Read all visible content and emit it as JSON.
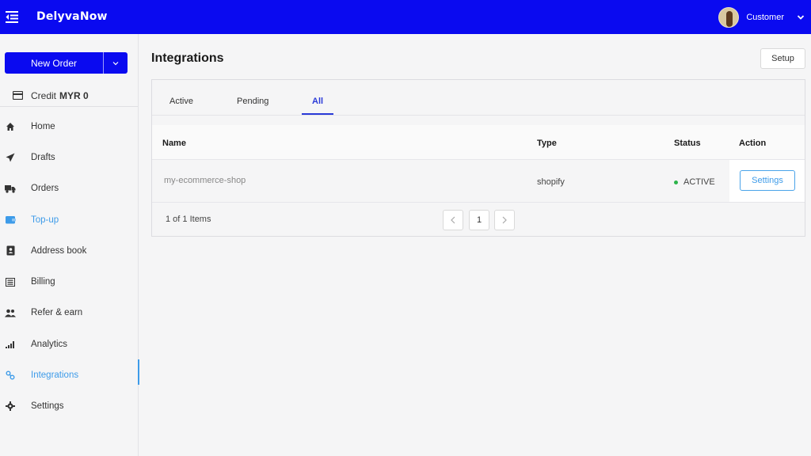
{
  "app": {
    "brand": "DelyvaNow"
  },
  "user": {
    "name": "Customer"
  },
  "sidebar": {
    "new_order_label": "New Order",
    "credit_label": "Credit",
    "credit_value": "MYR 0",
    "items": [
      {
        "label": "Home",
        "icon": "home-icon"
      },
      {
        "label": "Drafts",
        "icon": "paper-plane-icon"
      },
      {
        "label": "Orders",
        "icon": "truck-icon"
      },
      {
        "label": "Top-up",
        "icon": "wallet-icon"
      },
      {
        "label": "Address book",
        "icon": "contact-book-icon"
      },
      {
        "label": "Billing",
        "icon": "list-icon"
      },
      {
        "label": "Refer & earn",
        "icon": "users-icon"
      },
      {
        "label": "Analytics",
        "icon": "bar-chart-icon"
      },
      {
        "label": "Integrations",
        "icon": "link-icon"
      },
      {
        "label": "Settings",
        "icon": "gear-icon"
      }
    ]
  },
  "main": {
    "title": "Integrations",
    "setup_label": "Setup",
    "tabs": [
      {
        "label": "Active"
      },
      {
        "label": "Pending"
      },
      {
        "label": "All"
      }
    ],
    "table": {
      "columns": [
        "Name",
        "Type",
        "Status",
        "Action"
      ],
      "rows": [
        {
          "name": "my-ecommerce-shop",
          "type": "shopify",
          "status": "ACTIVE",
          "action": "Settings"
        }
      ]
    },
    "pagination": {
      "summary": "1 of 1 Items",
      "page": "1"
    }
  },
  "colors": {
    "brand": "#0a0af0",
    "accent": "#3d9be9",
    "tab_active": "#2a3ad8",
    "status_active": "#2bb34a"
  }
}
